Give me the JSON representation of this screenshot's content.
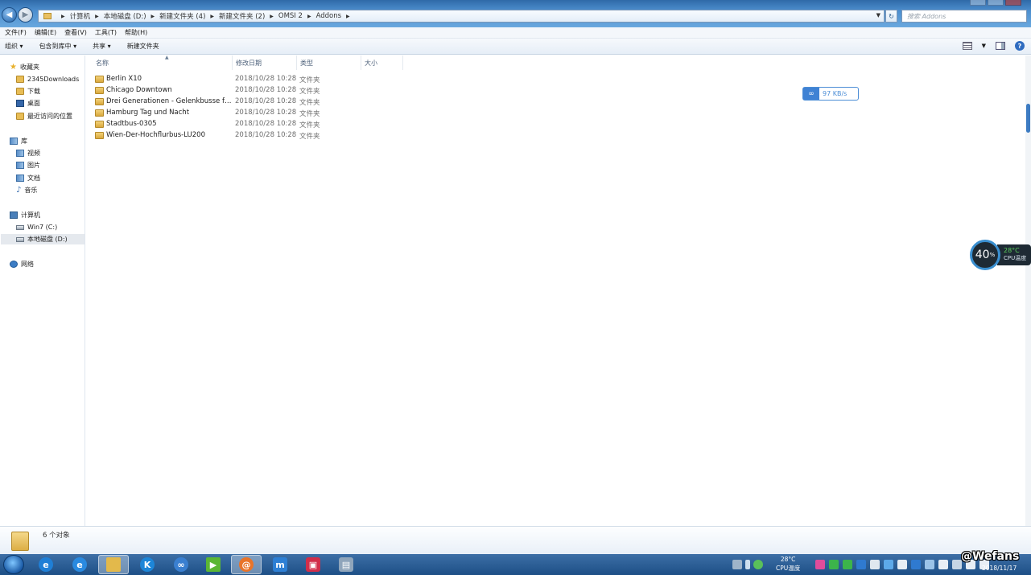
{
  "address": {
    "crumbs": [
      "计算机",
      "本地磁盘 (D:)",
      "新建文件夹 (4)",
      "新建文件夹 (2)",
      "OMSI 2",
      "Addons"
    ],
    "search_placeholder": "搜索 Addons"
  },
  "menu": [
    "文件(F)",
    "编辑(E)",
    "查看(V)",
    "工具(T)",
    "帮助(H)"
  ],
  "commands": [
    "组织 ▾",
    "包含到库中 ▾",
    "共享 ▾",
    "新建文件夹"
  ],
  "sidebar": {
    "favorites_label": "收藏夹",
    "favorites": [
      "2345Downloads",
      "下载",
      "桌面",
      "最近访问的位置"
    ],
    "libraries_label": "库",
    "libraries": [
      "视频",
      "图片",
      "文档",
      "音乐"
    ],
    "computer_label": "计算机",
    "drives": [
      "Win7 (C:)",
      "本地磁盘 (D:)"
    ],
    "network_label": "网络"
  },
  "columns": [
    "名称",
    "修改日期",
    "类型",
    "大小"
  ],
  "files": [
    {
      "name": "Berlin X10",
      "date": "2018/10/28 10:28",
      "type": "文件夹"
    },
    {
      "name": "Chicago Downtown",
      "date": "2018/10/28 10:28",
      "type": "文件夹"
    },
    {
      "name": "Drei Generationen - Gelenkbusse fue...",
      "date": "2018/10/28 10:28",
      "type": "文件夹"
    },
    {
      "name": "Hamburg Tag und Nacht",
      "date": "2018/10/28 10:28",
      "type": "文件夹"
    },
    {
      "name": "Stadtbus-0305",
      "date": "2018/10/28 10:28",
      "type": "文件夹"
    },
    {
      "name": "Wien-Der-Hochflurbus-LU200",
      "date": "2018/10/28 10:28",
      "type": "文件夹"
    }
  ],
  "speed_widget": "97 KB/s",
  "cpu_widget": {
    "percent": "40",
    "percent_unit": "%",
    "temp": "28°C",
    "label": "CPU温度"
  },
  "status": {
    "count": "6 个对象"
  },
  "taskbar": {
    "tray_temp": "28°C",
    "tray_label": "CPU温度",
    "date": "2018/11/17"
  },
  "watermark": "@Wefans",
  "colors": {
    "accent": "#3d7bc2",
    "taskbar": "#1d4f86"
  }
}
